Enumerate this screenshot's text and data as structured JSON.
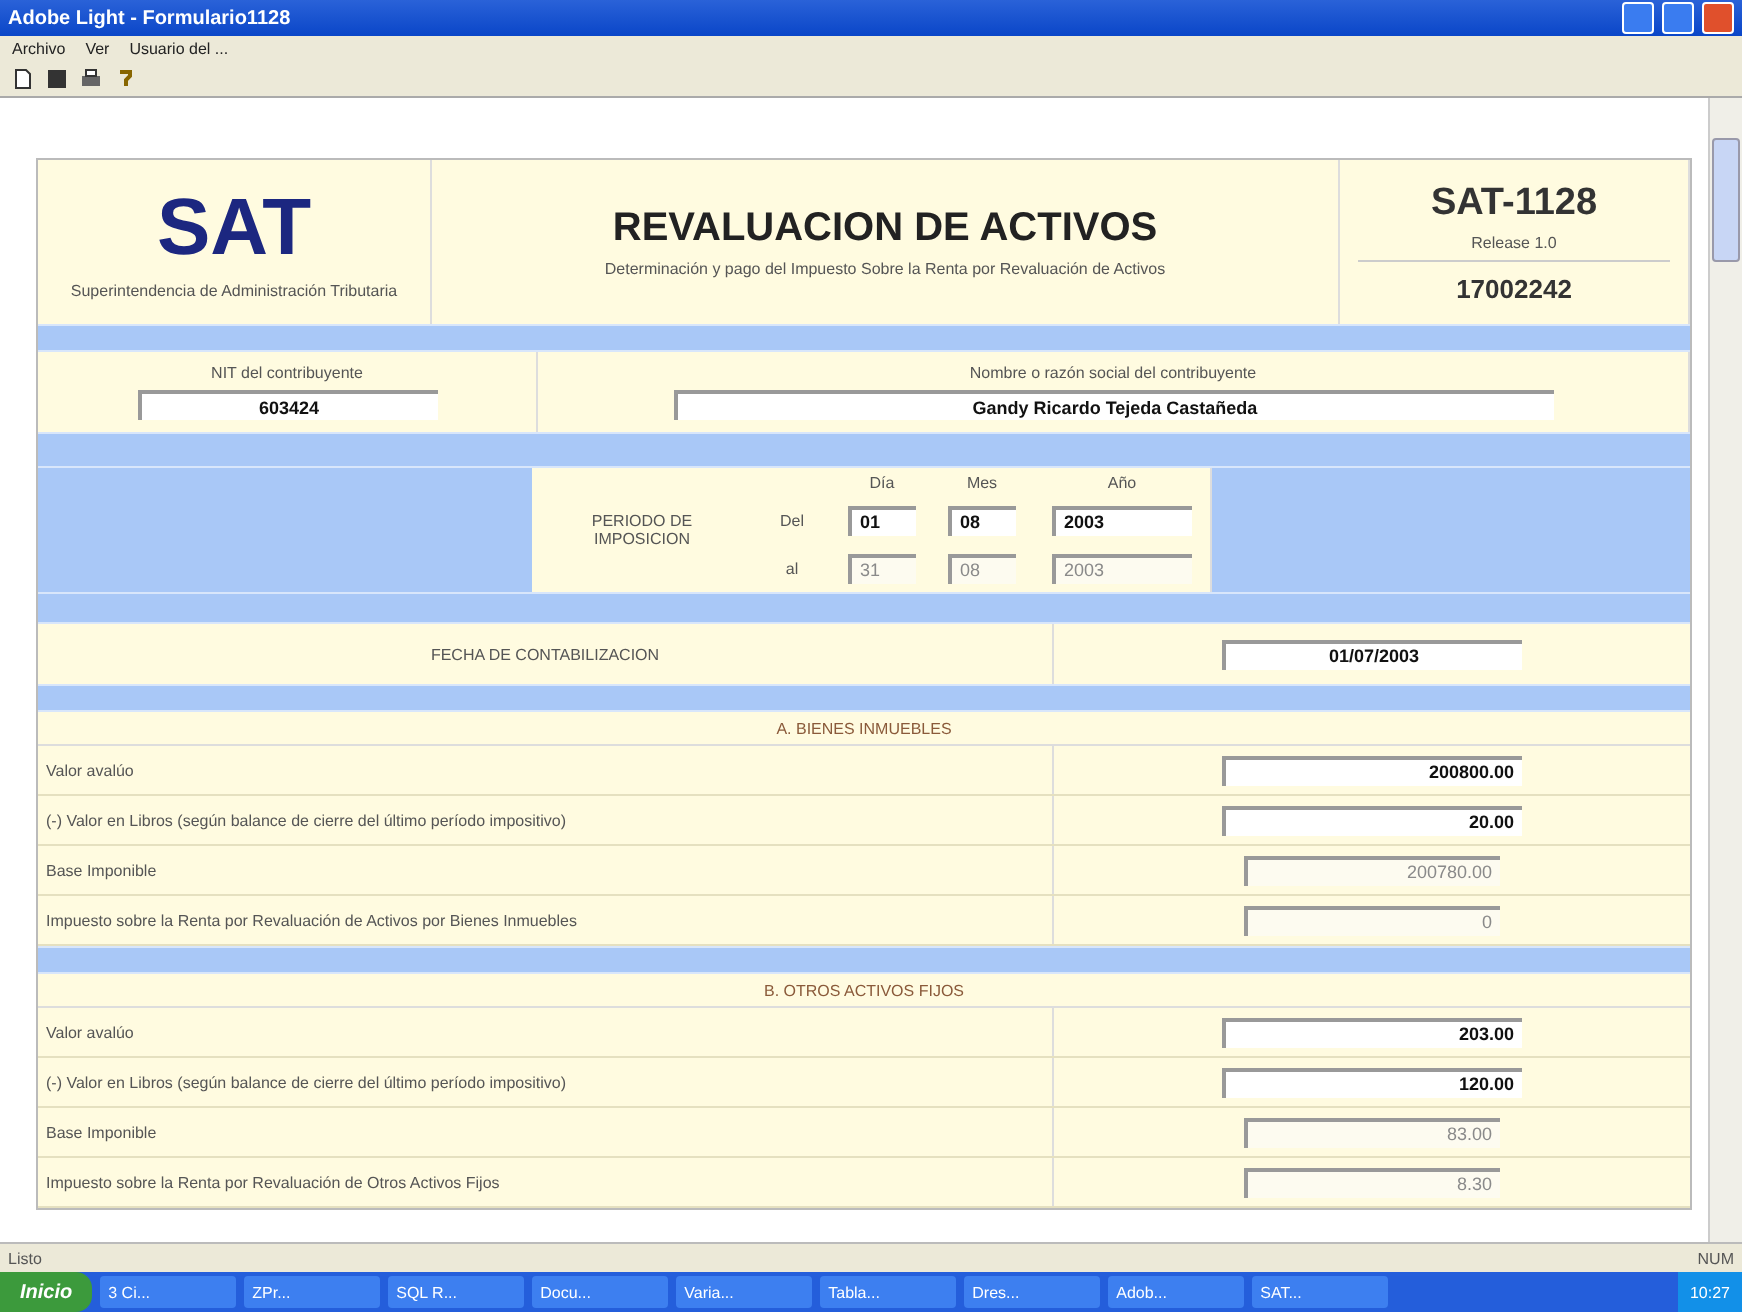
{
  "window": {
    "title": "Adobe Light - Formulario1128"
  },
  "menu": [
    "Archivo",
    "Ver",
    "Usuario del ..."
  ],
  "form": {
    "header": {
      "logo": "SAT",
      "logo_caption": "Superintendencia de Administración Tributaria",
      "title": "REVALUACION DE ACTIVOS",
      "subtitle": "Determinación y pago del Impuesto Sobre la Renta por Revaluación de Activos",
      "form_code": "SAT-1128",
      "version": "Release 1.0",
      "number": "17002242"
    },
    "taxpayer": {
      "nit_label": "NIT del contribuyente",
      "nit_value": "603424",
      "name_label": "Nombre o razón social del contribuyente",
      "name_value": "Gandy Ricardo Tejeda Castañeda"
    },
    "period": {
      "label": "PERIODO DE IMPOSICION",
      "columns": [
        "Día",
        "Mes",
        "Año"
      ],
      "rows": [
        {
          "label": "Del",
          "values": [
            "01",
            "08",
            "2003"
          ],
          "disabled": false
        },
        {
          "label": "al",
          "values": [
            "31",
            "08",
            "2003"
          ],
          "disabled": true
        }
      ]
    },
    "accounting_date": {
      "label": "FECHA DE CONTABILIZACION",
      "value": "01/07/2003"
    },
    "sections": [
      {
        "title": "A. BIENES INMUEBLES",
        "rows": [
          {
            "label": "Valor avalúo",
            "value": "200800.00",
            "disabled": false
          },
          {
            "label": "(-) Valor en Libros (según balance de cierre del último período impositivo)",
            "value": "20.00",
            "disabled": false
          },
          {
            "label": "Base Imponible",
            "value": "200780.00",
            "disabled": true
          },
          {
            "label": "Impuesto sobre la Renta por Revaluación de Activos por Bienes Inmuebles",
            "value": "0",
            "disabled": true
          }
        ]
      },
      {
        "title": "B. OTROS ACTIVOS FIJOS",
        "rows": [
          {
            "label": "Valor avalúo",
            "value": "203.00",
            "disabled": false
          },
          {
            "label": "(-) Valor en Libros (según balance de cierre del último período impositivo)",
            "value": "120.00",
            "disabled": false
          },
          {
            "label": "Base Imponible",
            "value": "83.00",
            "disabled": true
          },
          {
            "label": "Impuesto sobre la Renta por Revaluación de Otros Activos Fijos",
            "value": "8.30",
            "disabled": true
          }
        ]
      }
    ]
  },
  "status_bar": {
    "left": "Listo",
    "right": "NUM"
  },
  "taskbar": {
    "start": "Inicio",
    "items": [
      "3 Ci...",
      "ZPr...",
      "SQL R...",
      "Docu...",
      "Varia...",
      "Tabla...",
      "Dres...",
      "Adob...",
      "SAT..."
    ],
    "clock": "10:27"
  }
}
